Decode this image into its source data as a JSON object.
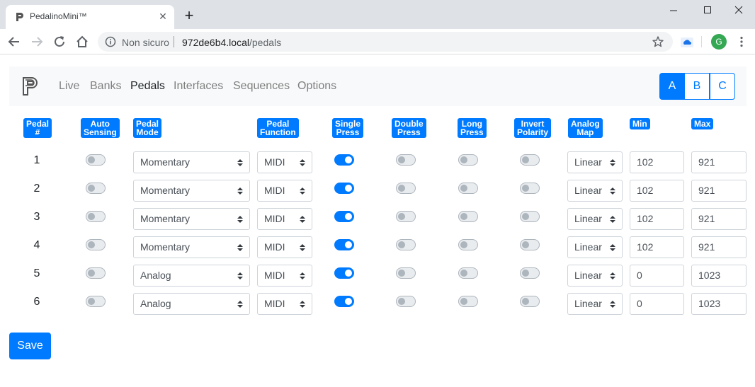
{
  "browser": {
    "tab_title": "PedalinoMini™",
    "security_label": "Non sicuro",
    "url_host": "972de6b4.local",
    "url_path": "/pedals",
    "profile_initial": "G"
  },
  "navbar": {
    "links": [
      "Live",
      "Banks",
      "Pedals",
      "Interfaces",
      "Sequences",
      "Options"
    ],
    "active_link": "Pedals",
    "banks": [
      "A",
      "B",
      "C"
    ],
    "active_bank": "A"
  },
  "table": {
    "headers": {
      "pedal": [
        "Pedal",
        "#"
      ],
      "auto": [
        "Auto",
        "Sensing"
      ],
      "mode": [
        "Pedal",
        "Mode"
      ],
      "function": [
        "Pedal",
        "Function"
      ],
      "single": [
        "Single",
        "Press"
      ],
      "double": [
        "Double",
        "Press"
      ],
      "long": [
        "Long",
        "Press"
      ],
      "invert": [
        "Invert",
        "Polarity"
      ],
      "analog": [
        "Analog",
        "Map"
      ],
      "min": [
        "Min"
      ],
      "max": [
        "Max"
      ]
    },
    "rows": [
      {
        "num": "1",
        "auto": false,
        "mode": "Momentary",
        "function": "MIDI",
        "single": true,
        "double": false,
        "long": false,
        "invert": false,
        "map": "Linear",
        "min": "102",
        "max": "921"
      },
      {
        "num": "2",
        "auto": false,
        "mode": "Momentary",
        "function": "MIDI",
        "single": true,
        "double": false,
        "long": false,
        "invert": false,
        "map": "Linear",
        "min": "102",
        "max": "921"
      },
      {
        "num": "3",
        "auto": false,
        "mode": "Momentary",
        "function": "MIDI",
        "single": true,
        "double": false,
        "long": false,
        "invert": false,
        "map": "Linear",
        "min": "102",
        "max": "921"
      },
      {
        "num": "4",
        "auto": false,
        "mode": "Momentary",
        "function": "MIDI",
        "single": true,
        "double": false,
        "long": false,
        "invert": false,
        "map": "Linear",
        "min": "102",
        "max": "921"
      },
      {
        "num": "5",
        "auto": false,
        "mode": "Analog",
        "function": "MIDI",
        "single": true,
        "double": false,
        "long": false,
        "invert": false,
        "map": "Linear",
        "min": "0",
        "max": "1023"
      },
      {
        "num": "6",
        "auto": false,
        "mode": "Analog",
        "function": "MIDI",
        "single": true,
        "double": false,
        "long": false,
        "invert": false,
        "map": "Linear",
        "min": "0",
        "max": "1023"
      }
    ]
  },
  "actions": {
    "save_label": "Save"
  },
  "colors": {
    "primary": "#007bff",
    "navbar_bg": "#f8f9fa",
    "chrome_bg": "#dee1e6"
  }
}
